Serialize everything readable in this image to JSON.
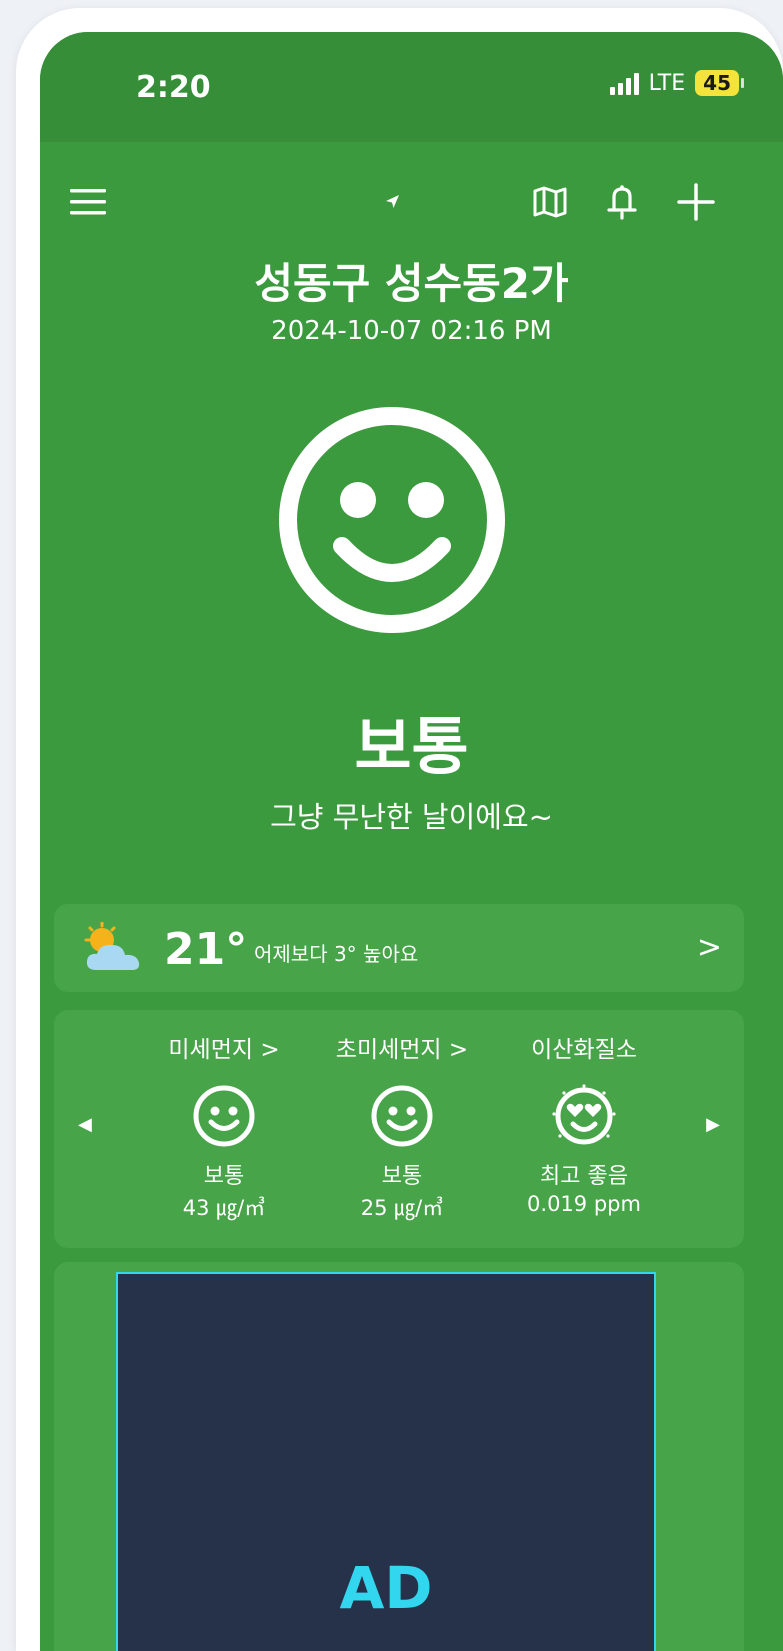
{
  "status_bar": {
    "time": "2:20",
    "network": "LTE",
    "battery": "45"
  },
  "header": {
    "location": "성동구 성수동2가",
    "datetime": "2024-10-07 02:16 PM"
  },
  "overall": {
    "status": "보통",
    "message": "그냥 무난한 날이에요~"
  },
  "weather": {
    "temperature": "21°",
    "comparison": "어제보다 3° 높아요",
    "chevron": ">"
  },
  "pollutants": [
    {
      "name": "미세먼지 >",
      "status": "보통",
      "value": "43 ㎍/㎥",
      "face": "smile"
    },
    {
      "name": "초미세먼지 >",
      "status": "보통",
      "value": "25 ㎍/㎥",
      "face": "smile"
    },
    {
      "name": "이산화질소",
      "status": "최고 좋음",
      "value": "0.019 ppm",
      "face": "heart-eyes"
    }
  ],
  "ad": {
    "label": "AD"
  },
  "icons": {
    "menu": "menu-icon",
    "location": "location-arrow-icon",
    "map": "map-icon",
    "bell": "bell-icon",
    "add": "plus-icon",
    "weather": "partly-cloudy-icon"
  },
  "colors": {
    "background": "#3c9a3e",
    "card": "#47a449",
    "ad_border": "#33d6ef",
    "ad_background": "#26324a"
  }
}
